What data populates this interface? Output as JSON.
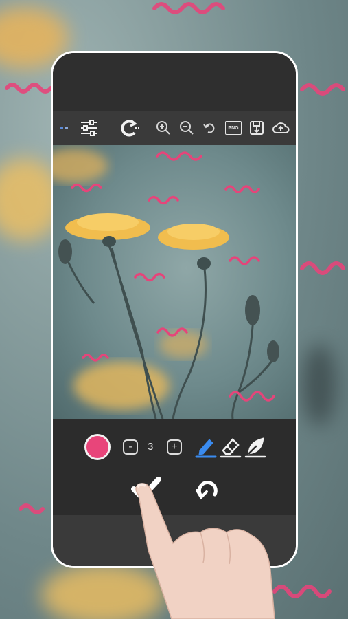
{
  "colors": {
    "accent_pink": "#e8457a",
    "squiggle": "#e5457a",
    "toolbar_bg": "#3a3a3a",
    "panel_bg": "#2c2c2c",
    "active_tool": "#3a8bf0"
  },
  "toolbar": {
    "items": [
      {
        "icon": "menu-dots-icon"
      },
      {
        "icon": "sliders-icon"
      },
      {
        "icon": "rotate-icon"
      },
      {
        "icon": "zoom-in-icon"
      },
      {
        "icon": "zoom-out-icon"
      },
      {
        "icon": "undo-icon"
      },
      {
        "icon": "png-icon",
        "label": "PNG"
      },
      {
        "icon": "save-icon"
      },
      {
        "icon": "upload-icon"
      }
    ]
  },
  "brush": {
    "size_value": "3",
    "decrease_label": "-",
    "increase_label": "+",
    "selected_tool": "pen"
  },
  "tools": [
    "pen-icon",
    "eraser-icon",
    "leaf-brush-icon"
  ],
  "actions": {
    "confirm": "check-icon",
    "reset": "redo-icon"
  }
}
